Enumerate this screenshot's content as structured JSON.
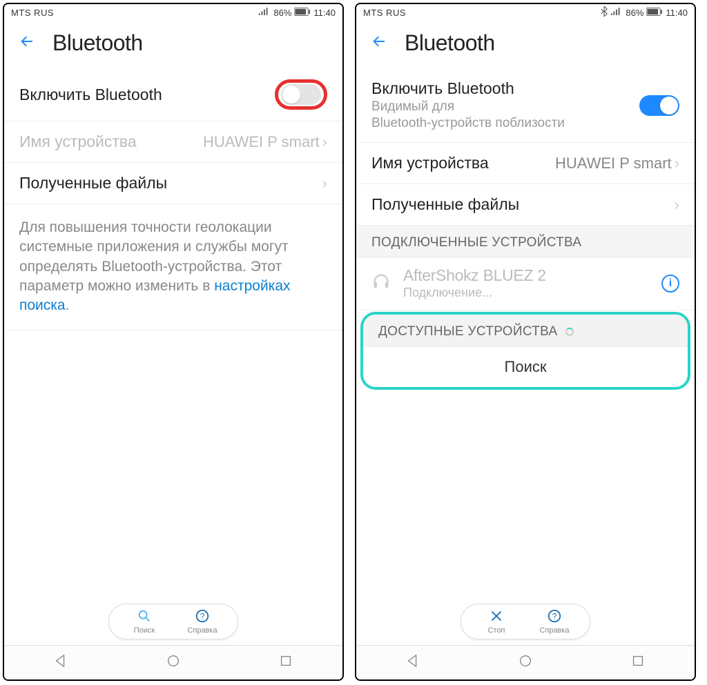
{
  "statusbar": {
    "carrier": "MTS RUS",
    "battery_pct": "86%",
    "time": "11:40"
  },
  "header": {
    "title": "Bluetooth"
  },
  "left": {
    "enable_bt": "Включить Bluetooth",
    "device_name_label": "Имя устройства",
    "device_name_value": "HUAWEI P smart",
    "received_files": "Полученные файлы",
    "info_text": "Для повышения точности геолокации системные приложения и службы могут определять Bluetooth-устройства. Этот параметр можно изменить в ",
    "info_link": "настройках поиска"
  },
  "right": {
    "enable_bt": "Включить Bluetooth",
    "visible_line1": "Видимый для",
    "visible_line2": "Bluetooth-устройств поблизости",
    "device_name_label": "Имя устройства",
    "device_name_value": "HUAWEI P smart",
    "received_files": "Полученные файлы",
    "paired_header": "ПОДКЛЮЧЕННЫЕ УСТРОЙСТВА",
    "paired_device": "AfterShokz BLUEZ 2",
    "paired_status": "Подключение...",
    "available_header": "ДОСТУПНЫЕ УСТРОЙСТВА",
    "search_btn": "Поиск"
  },
  "pill": {
    "search": "Поиск",
    "help": "Справка",
    "stop": "Стоп"
  }
}
